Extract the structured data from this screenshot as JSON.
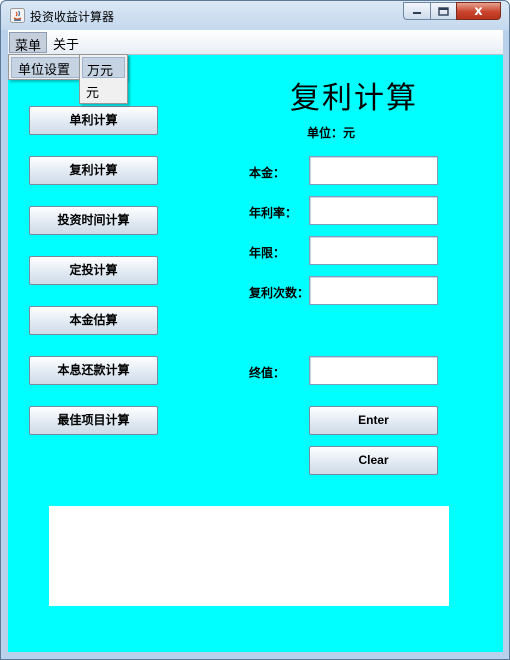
{
  "window": {
    "title": "投资收益计算器",
    "close_glyph": "x"
  },
  "menubar": {
    "items": [
      {
        "label": "菜单",
        "active": true
      },
      {
        "label": "关于",
        "active": false
      }
    ]
  },
  "dropdown": {
    "item_label": "单位设置",
    "submenu": [
      "万元",
      "元"
    ]
  },
  "left_buttons": [
    "单利计算",
    "复利计算",
    "投资时间计算",
    "定投计算",
    "本金估算",
    "本息还款计算",
    "最佳项目计算"
  ],
  "main": {
    "title": "复利计算",
    "unit_prefix": "单位：",
    "unit_value": "元",
    "fields": {
      "principal_label": "本金：",
      "rate_label": "年利率：",
      "years_label": "年限：",
      "times_label": "复利次数：",
      "final_label": "终值：",
      "principal_value": "",
      "rate_value": "",
      "years_value": "",
      "times_value": "",
      "final_value": ""
    },
    "enter_label": "Enter",
    "clear_label": "Clear",
    "result_text": ""
  },
  "colors": {
    "content_bg": "#00ffff",
    "result_bg": "#ffffff"
  }
}
